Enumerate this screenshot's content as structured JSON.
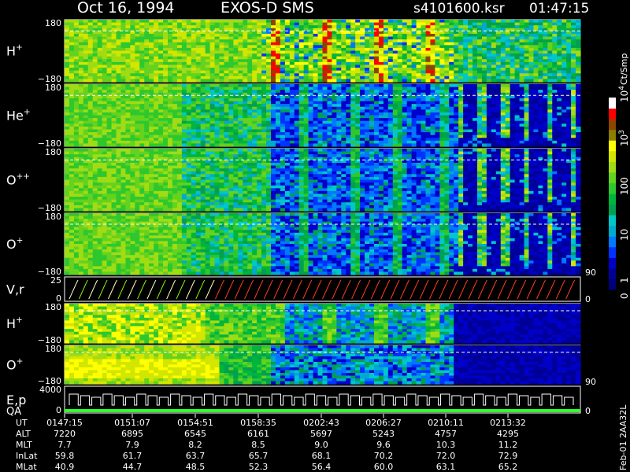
{
  "header": {
    "date": "Oct 16, 1994",
    "instrument": "EXOS-D SMS",
    "file": "s4101600.ksr",
    "time": "01:47:15"
  },
  "colors": {
    "background": "#000000",
    "text": "#ffffff",
    "scale": [
      "#00007a",
      "#000099",
      "#0000c8",
      "#0033ff",
      "#0078ff",
      "#00aacc",
      "#00c8c8",
      "#00a050",
      "#00b43c",
      "#2ec82e",
      "#64d21e",
      "#a0dc14",
      "#d2e600",
      "#ffff00",
      "#8b7d00",
      "#8b4500",
      "#ff0000",
      "#ffffff"
    ],
    "profile_h": "#ffffff",
    "profile_low": "#ffffbe",
    "profile_mid": "#8cf000",
    "profile_high": "#ff3c1e",
    "qa_bar": "#30ff30"
  },
  "chart_data": {
    "type": "heatmap",
    "colorbar": {
      "label": "Ct/Smp",
      "ticks": [
        {
          "label": "10",
          "sup": "4",
          "value": 10000
        },
        {
          "label": "10",
          "sup": "3",
          "value": 1000
        },
        {
          "label": "100",
          "sup": "",
          "value": 100
        },
        {
          "label": "10",
          "sup": "",
          "value": 10
        },
        {
          "label": "1",
          "sup": "",
          "value": 1
        },
        {
          "label": "0",
          "sup": "",
          "value": 0
        }
      ]
    },
    "time_axis": {
      "utc_label": "UT",
      "alt_label": "ALT",
      "mlt_label": "MLT",
      "inlat_label": "InLat",
      "mlat_label": "MLat",
      "columns": [
        {
          "UT": "0147:15",
          "ALT": "7220",
          "MLT": "7.7",
          "InLat": "59.8",
          "MLat": "40.9"
        },
        {
          "UT": "0151:07",
          "ALT": "6895",
          "MLT": "7.9",
          "InLat": "61.7",
          "MLat": "44.7"
        },
        {
          "UT": "0154:51",
          "ALT": "6545",
          "MLT": "8.2",
          "InLat": "63.7",
          "MLat": "48.5"
        },
        {
          "UT": "0158:35",
          "ALT": "6161",
          "MLT": "8.5",
          "InLat": "65.7",
          "MLat": "52.3"
        },
        {
          "UT": "0202:43",
          "ALT": "5697",
          "MLT": "9.0",
          "InLat": "68.1",
          "MLat": "56.4"
        },
        {
          "UT": "0206:27",
          "ALT": "5243",
          "MLT": "9.6",
          "InLat": "70.2",
          "MLat": "60.0"
        },
        {
          "UT": "0210:11",
          "ALT": "4757",
          "MLT": "10.3",
          "InLat": "72.0",
          "MLat": "63.1"
        },
        {
          "UT": "0213:32",
          "ALT": "4295",
          "MLT": "11.2",
          "InLat": "72.9",
          "MLat": "65.2"
        }
      ]
    },
    "panels": [
      {
        "id": "h",
        "name": "H",
        "sup": "+",
        "ymax": "180",
        "ymin": "−180",
        "kind": "heatmap"
      },
      {
        "id": "he",
        "name": "He",
        "sup": "+",
        "ymax": "180",
        "ymin": "−180",
        "kind": "heatmap"
      },
      {
        "id": "opp",
        "name": "O",
        "sup": "++",
        "ymax": "180",
        "ymin": "−180",
        "kind": "heatmap"
      },
      {
        "id": "op",
        "name": "O",
        "sup": "+",
        "ymax": "180",
        "ymin": "−180",
        "right_label": "90",
        "kind": "heatmap"
      },
      {
        "id": "vr",
        "name": "V,r",
        "sup": "",
        "ymax": "25",
        "ymin": "0",
        "right_label": "0",
        "kind": "line"
      },
      {
        "id": "h2",
        "name": "H",
        "sup": "+",
        "ymax": "180",
        "ymin": "−180",
        "kind": "heatmap"
      },
      {
        "id": "o2",
        "name": "O",
        "sup": "+",
        "ymax": "180",
        "ymin": "−180",
        "right_label": "90",
        "kind": "heatmap"
      },
      {
        "id": "ep",
        "name": "E,p",
        "name2": "QA",
        "sup": "",
        "ymax": "4000",
        "ymin": "0",
        "right_label": "0",
        "kind": "line"
      }
    ]
  },
  "footer": {
    "side_label": "Feb-01 2AA32L"
  }
}
